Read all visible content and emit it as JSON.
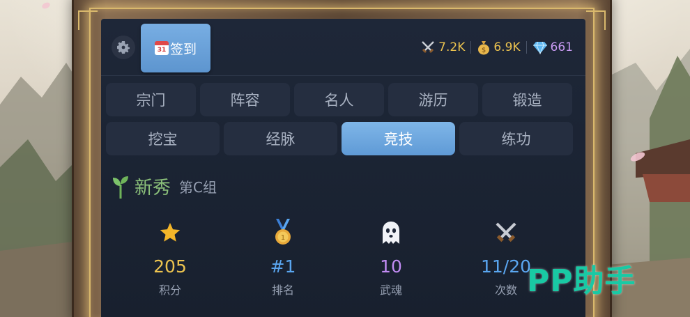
{
  "topbar": {
    "signin_label": "签到",
    "calendar_day": "31"
  },
  "currencies": [
    {
      "icon": "crossed-swords-icon",
      "value": "7.2K",
      "color": "#ecc34f"
    },
    {
      "icon": "money-bag-icon",
      "value": "6.9K",
      "color": "#ecc34f"
    },
    {
      "icon": "diamond-icon",
      "value": "661",
      "color": "#c89af2"
    }
  ],
  "tabs_row1": [
    "宗门",
    "阵容",
    "名人",
    "游历",
    "锻造"
  ],
  "tabs_row2": [
    "挖宝",
    "经脉",
    "竞技",
    "练功"
  ],
  "active_tab": "竞技",
  "rank": {
    "title": "新秀",
    "group": "第C组"
  },
  "stats": [
    {
      "icon": "star-icon",
      "value": "205",
      "label": "积分"
    },
    {
      "icon": "medal-icon",
      "value": "#1",
      "label": "排名"
    },
    {
      "icon": "ghost-icon",
      "value": "10",
      "label": "武魂"
    },
    {
      "icon": "crossed-swords-icon",
      "value": "11/20",
      "label": "次数"
    }
  ],
  "watermark": "PP助手",
  "colors": {
    "accent_blue": "#5f9ad6",
    "gold": "#ecc34f",
    "purple": "#c18bf2",
    "rank_green": "#8bc07a"
  }
}
